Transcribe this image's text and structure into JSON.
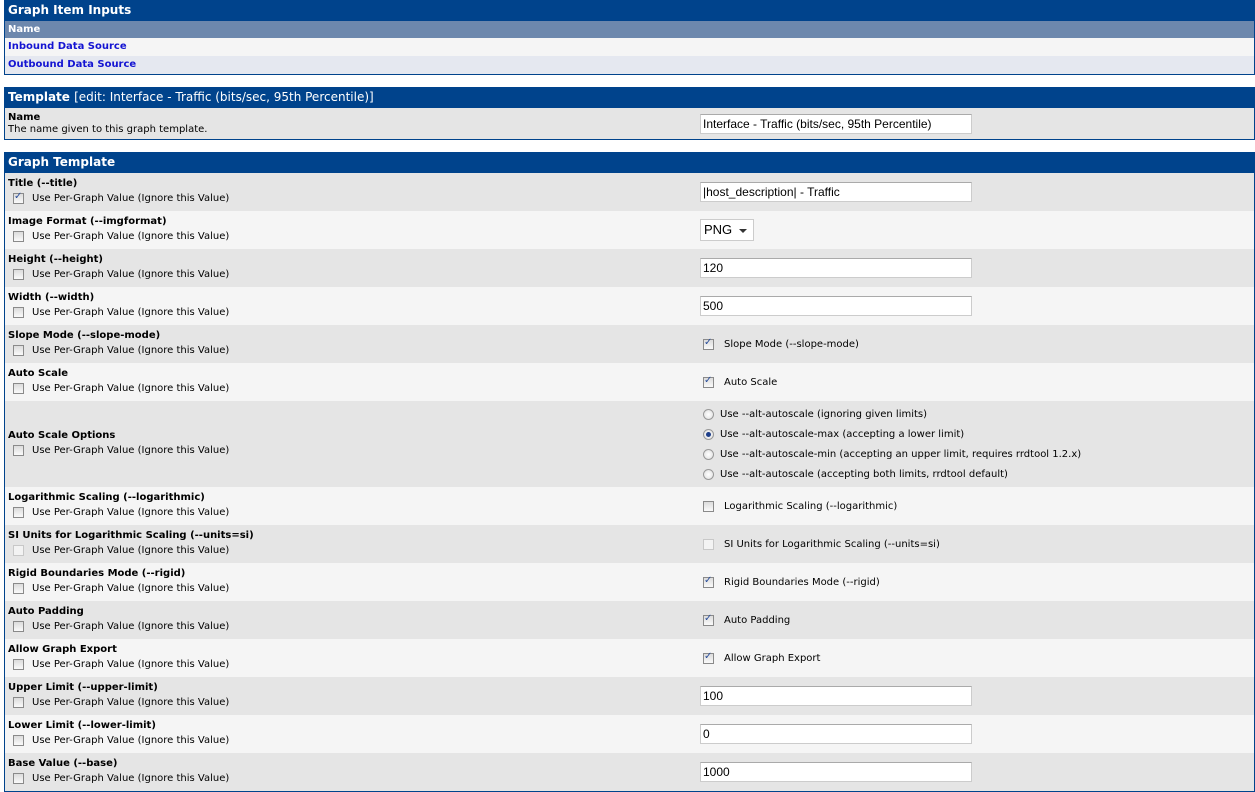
{
  "graph_item_inputs": {
    "title": "Graph Item Inputs",
    "column_header": "Name",
    "items": [
      "Inbound Data Source",
      "Outbound Data Source"
    ]
  },
  "template": {
    "title": "Template",
    "subtitle": "[edit: Interface - Traffic (bits/sec, 95th Percentile)]",
    "name_label": "Name",
    "name_desc": "The name given to this graph template.",
    "name_value": "Interface - Traffic (bits/sec, 95th Percentile)"
  },
  "graph_template": {
    "title": "Graph Template",
    "per_graph_label": "Use Per-Graph Value (Ignore this Value)",
    "fields": {
      "title": {
        "label": "Title (--title)",
        "per_graph": true,
        "value": "|host_description| - Traffic"
      },
      "imgformat": {
        "label": "Image Format (--imgformat)",
        "per_graph": false,
        "value": "PNG"
      },
      "height": {
        "label": "Height (--height)",
        "per_graph": false,
        "value": "120"
      },
      "width": {
        "label": "Width (--width)",
        "per_graph": false,
        "value": "500"
      },
      "slope": {
        "label": "Slope Mode (--slope-mode)",
        "per_graph": false,
        "check_label": "Slope Mode (--slope-mode)",
        "checked": true
      },
      "autoscale": {
        "label": "Auto Scale",
        "per_graph": false,
        "check_label": "Auto Scale",
        "checked": true
      },
      "autoscale_opts": {
        "label": "Auto Scale Options",
        "per_graph": false,
        "options": [
          "Use --alt-autoscale (ignoring given limits)",
          "Use --alt-autoscale-max (accepting a lower limit)",
          "Use --alt-autoscale-min (accepting an upper limit, requires rrdtool 1.2.x)",
          "Use --alt-autoscale (accepting both limits, rrdtool default)"
        ],
        "selected_index": 1
      },
      "log": {
        "label": "Logarithmic Scaling (--logarithmic)",
        "per_graph": false,
        "check_label": "Logarithmic Scaling (--logarithmic)",
        "checked": false
      },
      "si": {
        "label": "SI Units for Logarithmic Scaling (--units=si)",
        "per_graph": false,
        "check_label": "SI Units for Logarithmic Scaling (--units=si)",
        "checked": false,
        "disabled": true
      },
      "rigid": {
        "label": "Rigid Boundaries Mode (--rigid)",
        "per_graph": false,
        "check_label": "Rigid Boundaries Mode (--rigid)",
        "checked": true
      },
      "padding": {
        "label": "Auto Padding",
        "per_graph": false,
        "check_label": "Auto Padding",
        "checked": true
      },
      "export": {
        "label": "Allow Graph Export",
        "per_graph": false,
        "check_label": "Allow Graph Export",
        "checked": true
      },
      "upper": {
        "label": "Upper Limit (--upper-limit)",
        "per_graph": false,
        "value": "100"
      },
      "lower": {
        "label": "Lower Limit (--lower-limit)",
        "per_graph": false,
        "value": "0"
      },
      "base": {
        "label": "Base Value (--base)",
        "per_graph": false,
        "value": "1000"
      }
    }
  },
  "colors": {
    "header_bg": "#00438C",
    "subheader_bg": "#6D88AD",
    "link": "#1414D2",
    "row_dark": "#E5E5E5",
    "row_light": "#F5F5F5"
  }
}
